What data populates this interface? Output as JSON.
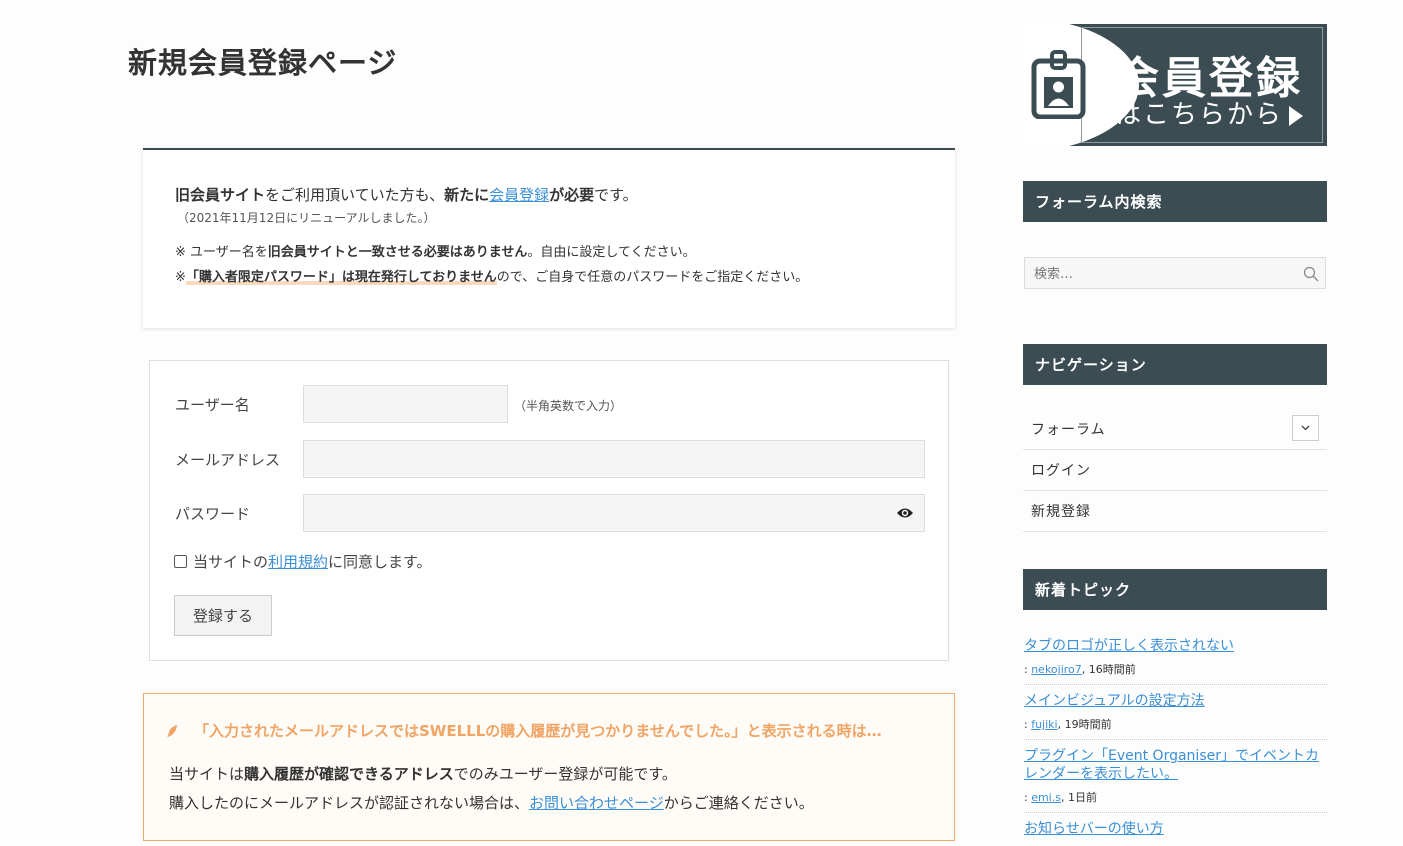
{
  "page": {
    "title": "新規会員登録ページ"
  },
  "notice": {
    "line1_pre": "旧会員サイト",
    "line1_mid": "をご利用頂いていた方も、",
    "line1_new": "新たに",
    "line1_link": "会員登録",
    "line1_post_bold": "が必要",
    "line1_end": "です。",
    "sub": "（2021年11月12日にリニューアルしました。）",
    "note1_pre": "※ ユーザー名を",
    "note1_bold": "旧会員サイトと一致させる必要はありません",
    "note1_post": "。自由に設定してください。",
    "note2_pre": "※",
    "note2_marker": "「購入者限定パスワード」は現在発行しておりません",
    "note2_post": "ので、ご自身で任意のパスワードをご指定ください。"
  },
  "form": {
    "username_label": "ユーザー名",
    "username_hint": "（半角英数で入力）",
    "email_label": "メールアドレス",
    "password_label": "パスワード",
    "agree_pre": "当サイトの",
    "agree_link": "利用規約",
    "agree_post": "に同意します。",
    "submit_label": "登録する"
  },
  "alert": {
    "title": "「入力されたメールアドレスではSWELLLの購入履歴が見つかりませんでした。」と表示される時は…",
    "line1_pre": "当サイトは",
    "line1_bold": "購入履歴が確認できるアドレス",
    "line1_post": "でのみユーザー登録が可能です。",
    "line2_pre": "購入したのにメールアドレスが認証されない場合は、",
    "line2_link": "お問い合わせページ",
    "line2_post": "からご連絡ください。"
  },
  "sidebar": {
    "banner_big": "会員登録",
    "banner_small": "はこちらから",
    "search_heading": "フォーラム内検索",
    "search_placeholder": "検索…",
    "nav_heading": "ナビゲーション",
    "nav_items": [
      "フォーラム",
      "ログイン",
      "新規登録"
    ],
    "topics_heading": "新着トピック",
    "topics": [
      {
        "title": "タブのロゴが正しく表示されない",
        "user": "nekojiro7",
        "time": ", 16時間前"
      },
      {
        "title": "メインビジュアルの設定方法",
        "user": "fujiki",
        "time": ", 19時間前"
      },
      {
        "title": "プラグイン「Event Organiser」でイベントカレンダーを表示したい。",
        "user": "emi.s",
        "time": ", 1日前"
      },
      {
        "title": "お知らせバーの使い方",
        "user": "",
        "time": ""
      }
    ],
    "meta_prefix": ": "
  },
  "colors": {
    "header_bg": "#3c4c53",
    "link": "#3b8fd6",
    "alert_accent": "#f0a465"
  }
}
